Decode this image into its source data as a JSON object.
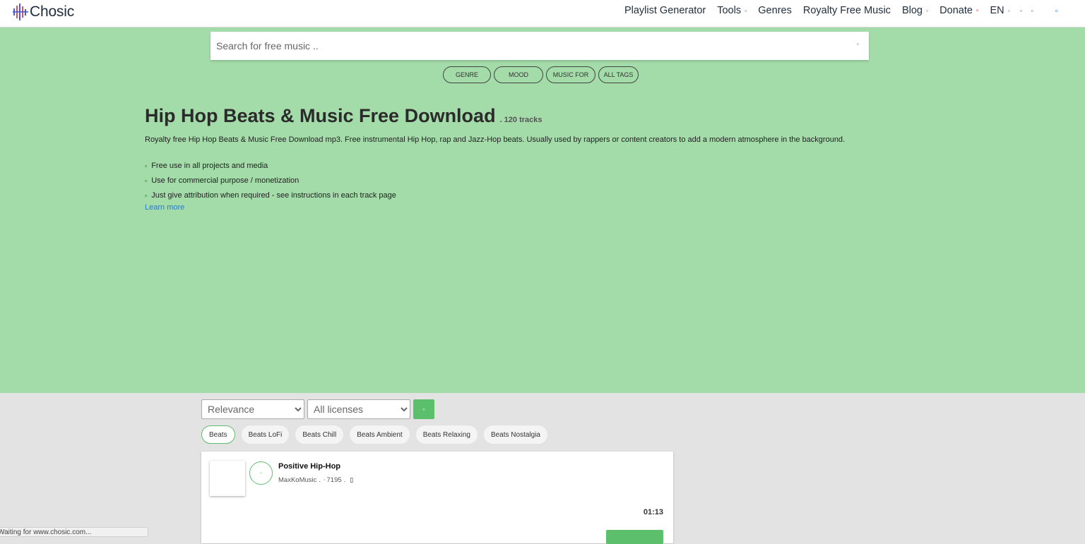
{
  "header": {
    "logo_text": "Chosic",
    "nav": [
      {
        "label": "Playlist Generator",
        "glyph": ""
      },
      {
        "label": "Tools",
        "glyph": "▫"
      },
      {
        "label": "Genres",
        "glyph": ""
      },
      {
        "label": "Royalty Free Music",
        "glyph": ""
      },
      {
        "label": "Blog",
        "glyph": "▫"
      },
      {
        "label": "Donate",
        "glyph": "▫"
      },
      {
        "label": "EN",
        "glyph": "▫"
      }
    ],
    "extra_glyphs": "▫ ▫",
    "blue_glyph": "▫"
  },
  "search": {
    "placeholder": "Search for free music ..",
    "icon": "search-icon"
  },
  "tag_pills": [
    "GENRE",
    "MOOD",
    "MUSIC FOR",
    "ALL TAGS"
  ],
  "hero": {
    "title": "Hip Hop Beats & Music Free Download",
    "track_count": ". 120 tracks",
    "description": "Royalty free Hip Hop Beats & Music Free Download mp3. Free instrumental Hip Hop, rap and Jazz-Hop beats. Usually used by rappers or content creators to add a modern atmosphere in the background.",
    "features": [
      "Free use in all projects and media",
      "Use for commercial purpose / monetization",
      "Just give attribution when required - see instructions in each track page"
    ],
    "learn_more": "Learn more"
  },
  "filters": {
    "sort_selected": "Relevance",
    "license_selected": "All licenses"
  },
  "chips": [
    "Beats",
    "Beats LoFi",
    "Beats Chill",
    "Beats Ambient",
    "Beats Relaxing",
    "Beats Nostalgia"
  ],
  "track": {
    "title": "Positive Hip-Hop",
    "artist": "MaxKoMusic",
    "separator": ".",
    "likes": "7195",
    "likes_suffix": ".",
    "duration": "01:13"
  },
  "status_bar": "Waiting for www.chosic.com...",
  "colors": {
    "hero_bg": "#a3dba9",
    "accent_green": "#5cbf6c",
    "link_blue": "#2b7bc0"
  }
}
